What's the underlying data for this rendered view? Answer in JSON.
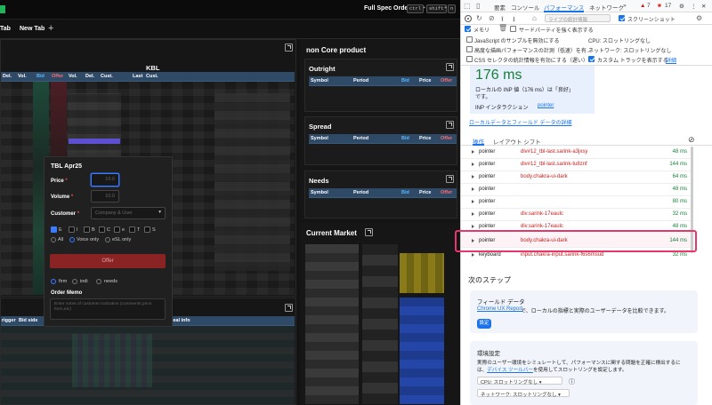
{
  "app": {
    "toolbar": {
      "full_spec_order": "Full Spec Order",
      "shortcut_keys": [
        "ctrl",
        "+",
        "shift",
        "+",
        "n"
      ]
    },
    "tabs": [
      {
        "label": "Tab"
      },
      {
        "label": "New Tab"
      }
    ],
    "add_tab": "+",
    "kbl_panel": {
      "title": "KBL",
      "columns": [
        "Del.",
        "Vol.",
        "Bid",
        "Offer",
        "Vol.",
        "Del.",
        "Cust.",
        "Last",
        "Cust."
      ]
    },
    "non_core": {
      "title": "non Core product",
      "sections": [
        {
          "title": "Outright",
          "columns": [
            "Symbol",
            "Period",
            "Bid",
            "Price",
            "Offer"
          ]
        },
        {
          "title": "Spread",
          "columns": [
            "Symbol",
            "Period",
            "Bid",
            "Price",
            "Offer"
          ]
        },
        {
          "title": "Needs",
          "columns": [
            "Symbol",
            "Period",
            "Bid",
            "Price",
            "Offer"
          ]
        }
      ]
    },
    "current_market": {
      "title": "Current Market"
    },
    "bottom_panel": {
      "columns": [
        "rigger",
        "Bid side",
        "deal info"
      ]
    },
    "ticket": {
      "header": "TBL  Apr25",
      "price_label": "Price",
      "price_value": "10.0",
      "volume_label": "Volume",
      "volume_value": "10.0",
      "customer_label": "Customer",
      "customer_placeholder": "Company & User",
      "required_mark": "*",
      "flags": [
        "E",
        "I",
        "B",
        "C",
        "e",
        "T",
        "S"
      ],
      "scope": [
        "All",
        "Voice only",
        "eSL only"
      ],
      "offer_button": "Offer",
      "firmness": [
        "firm",
        "indi",
        "needs"
      ],
      "memo_label": "Order Memo",
      "memo_placeholder": "Enter notes of customer indication (comments,price form,etc)"
    }
  },
  "devtools": {
    "tabs": [
      "要素",
      "コンソール",
      "パフォーマンス",
      "ネットワーク"
    ],
    "more_tabs": "»",
    "warnings": "7",
    "errors": "17",
    "toolbar": {
      "stats_placeholder": "ライブの統計情報",
      "screenshot_label": "スクリーンショット",
      "memory_label": "メモリ",
      "third_party_label": "サードパーティを強く表示する"
    },
    "options": {
      "disable_js_samples": "JavaScript のサンプルを無効にする",
      "cpu": "CPU:  スロットリングなし",
      "advanced_paint": "高度な描画パフォーマンスの計測（低速）を有…",
      "network": "ネットワーク:  スロットリングなし",
      "css_selector_stats": "CSS セレクタの統計情報を有効にする（遅い）",
      "custom_tracks": "カスタム トラックを表示する",
      "details_link": "詳細"
    },
    "inp": {
      "value": "176 ms",
      "description_line1": "ローカルの INP 値（176 ms）は「良好」",
      "description_line2": "です。",
      "interaction_label": "INP インタラクション",
      "interaction_link": "pointer"
    },
    "local_field_link": "ローカルデータとフィールド データの詳細",
    "subtabs": [
      "操作",
      "レイアウト シフト"
    ],
    "interactions": [
      {
        "name": "pointer",
        "selector": "div#12_tbl-last.sarink-a3jxsy",
        "ms": "48 ms"
      },
      {
        "name": "pointer",
        "selector": "div#12_tbl-last.sarink-tu8znf",
        "ms": "144 ms"
      },
      {
        "name": "pointer",
        "selector": "body.chakra-ui-dark",
        "ms": "64 ms"
      },
      {
        "name": "pointer",
        "selector": "",
        "ms": "48 ms"
      },
      {
        "name": "pointer",
        "selector": "",
        "ms": "80 ms"
      },
      {
        "name": "pointer",
        "selector": "div.sarink-17eaulc",
        "ms": "32 ms"
      },
      {
        "name": "pointer",
        "selector": "div.sarink-17eaulc",
        "ms": "48 ms"
      },
      {
        "name": "pointer",
        "selector": "body.chakra-ui-dark",
        "ms": "144 ms"
      },
      {
        "name": "keyboard",
        "selector": "input.chakra-input.sarink-f6s6msud",
        "ms": "32 ms"
      }
    ],
    "next_steps": {
      "title": "次のステップ",
      "field_data_title": "フィールド データ",
      "field_data_link": "Chrome UX Report",
      "field_data_text": "で、ローカルの指標と実際のユーザーデータを比較できます。",
      "setup_button": "設定",
      "env_title": "環境設定",
      "env_text_line1": "実際のユーザー環境をシミュレートして、パフォーマンスに関する問題を正確に検出するに",
      "env_text_line2_prefix": "は、",
      "env_text_link": "デバイス ツールバー",
      "env_text_line2_suffix": "を使用してスロットリングを設定します。",
      "cpu_select": "CPU: スロットリングなし",
      "net_select": "ネットワーク: スロットリングなし"
    }
  },
  "colors": {
    "accent": "#1a73e8",
    "highlight": "#e8366d",
    "offer": "#8a2424",
    "table_head": "#2e4a66",
    "good": "#188038"
  }
}
